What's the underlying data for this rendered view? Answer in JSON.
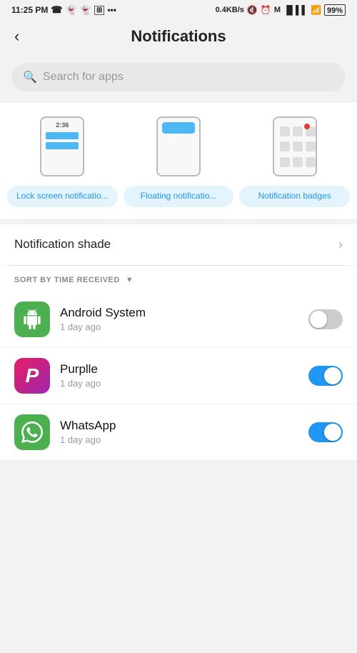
{
  "statusBar": {
    "time": "11:25 PM",
    "networkSpeed": "0.4KB/s",
    "battery": "99%"
  },
  "header": {
    "backLabel": "<",
    "title": "Notifications"
  },
  "search": {
    "placeholder": "Search for apps"
  },
  "quickOptions": [
    {
      "id": "lock-screen",
      "label": "Lock screen notificatio...",
      "clockText": "2:36"
    },
    {
      "id": "floating",
      "label": "Floating notificatio..."
    },
    {
      "id": "badges",
      "label": "Notification badges"
    }
  ],
  "notificationShade": {
    "label": "Notification shade"
  },
  "sortBar": {
    "label": "SORT BY TIME RECEIVED"
  },
  "apps": [
    {
      "name": "Android System",
      "time": "1 day ago",
      "enabled": false,
      "iconType": "android"
    },
    {
      "name": "Purplle",
      "time": "1 day ago",
      "enabled": true,
      "iconType": "purplle"
    },
    {
      "name": "WhatsApp",
      "time": "1 day ago",
      "enabled": true,
      "iconType": "whatsapp"
    }
  ]
}
